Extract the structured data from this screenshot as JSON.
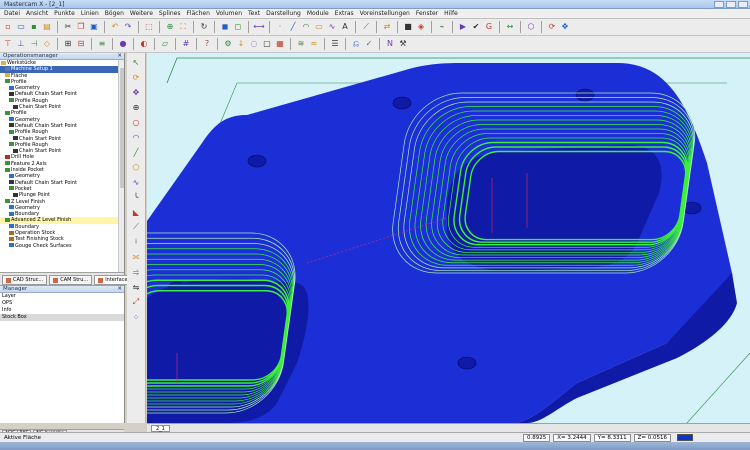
{
  "window": {
    "title": "Mastercam X  -  [2_1]"
  },
  "menu": [
    "Datei",
    "Ansicht",
    "Punkte",
    "Linien",
    "Bögen",
    "Weitere",
    "Splines",
    "Flächen",
    "Volumen",
    "Text",
    "Darstellung",
    "Module",
    "Extras",
    "Voreinstellungen",
    "Fenster",
    "Hilfe"
  ],
  "toolbar1": [
    "new-icon",
    "open-icon",
    "save-icon",
    "print-icon",
    "sep",
    "cut-icon",
    "copy-icon",
    "paste-icon",
    "sep",
    "undo-icon",
    "redo-icon",
    "sep",
    "select-all-icon",
    "sep",
    "zoom-icon",
    "fit-icon",
    "sep",
    "repaint-icon",
    "sep",
    "shade-icon",
    "wire-icon",
    "sep",
    "measure-icon",
    "sep",
    "point-icon",
    "line-icon",
    "arc-icon",
    "rect-icon",
    "spline-icon",
    "text-icon",
    "sep",
    "trim-icon",
    "sep",
    "xform-icon",
    "sep",
    "solid-icon",
    "surface-icon",
    "sep",
    "toolpath-icon",
    "sep",
    "simulate-icon",
    "verify-icon",
    "post-icon",
    "sep",
    "dim-icon",
    "sep",
    "wireframe-icon",
    "sep",
    "rotate-icon",
    "pan-icon"
  ],
  "toolbar2": [
    "view-top-icon",
    "view-front-icon",
    "view-side-icon",
    "view-iso-icon",
    "sep",
    "cplane-icon",
    "tplane-icon",
    "sep",
    "level-icon",
    "sep",
    "color-icon",
    "sep",
    "attr-icon",
    "sep",
    "plane-icon",
    "sep",
    "grid-icon",
    "sep",
    "analyze-icon",
    "sep",
    "mill-icon",
    "drill-icon",
    "contour-icon",
    "pocket-icon",
    "face-icon",
    "sep",
    "rough-icon",
    "finish-icon",
    "sep",
    "ops-icon",
    "sep",
    "backplot-icon",
    "verify2-icon",
    "sep",
    "nc-icon",
    "setup-icon"
  ],
  "ops_panel": {
    "header": "Operationsmanager"
  },
  "tree": [
    {
      "label": "Werkstücke",
      "indent": 0,
      "icon": "folder-icon"
    },
    {
      "label": "Machine Setup 1",
      "indent": 1,
      "icon": "machine-icon",
      "state": "selected"
    },
    {
      "label": "Fläche",
      "indent": 1,
      "icon": "folder-icon"
    },
    {
      "label": "Profile",
      "indent": 1,
      "icon": "op-icon"
    },
    {
      "label": "Geometry",
      "indent": 2,
      "icon": "geom-icon"
    },
    {
      "label": "Default Chain Start Point",
      "indent": 2,
      "icon": "pin-icon"
    },
    {
      "label": "Profile Rough",
      "indent": 2,
      "icon": "op-icon"
    },
    {
      "label": "Chain Start Point",
      "indent": 3,
      "icon": "pin-icon"
    },
    {
      "label": "Profile",
      "indent": 1,
      "icon": "op-icon"
    },
    {
      "label": "Geometry",
      "indent": 2,
      "icon": "geom-icon"
    },
    {
      "label": "Default Chain Start Point",
      "indent": 2,
      "icon": "pin-icon"
    },
    {
      "label": "Profile Rough",
      "indent": 2,
      "icon": "op-icon"
    },
    {
      "label": "Chain Start Point",
      "indent": 3,
      "icon": "pin-icon"
    },
    {
      "label": "Profile Rough",
      "indent": 2,
      "icon": "op-icon"
    },
    {
      "label": "Chain Start Point",
      "indent": 3,
      "icon": "pin-icon"
    },
    {
      "label": "Drill Hole",
      "indent": 1,
      "icon": "drill-icon"
    },
    {
      "label": "Feature 2 Axis",
      "indent": 1,
      "icon": "op-icon"
    },
    {
      "label": "Inside Pocket",
      "indent": 1,
      "icon": "op-icon"
    },
    {
      "label": "Geometry",
      "indent": 2,
      "icon": "geom-icon"
    },
    {
      "label": "Default Chain Start Point",
      "indent": 2,
      "icon": "pin-icon"
    },
    {
      "label": "Pocket",
      "indent": 2,
      "icon": "op-icon"
    },
    {
      "label": "Plunge Point",
      "indent": 3,
      "icon": "pin-icon"
    },
    {
      "label": "Z Level Finish",
      "indent": 1,
      "icon": "op-icon"
    },
    {
      "label": "Geometry",
      "indent": 2,
      "icon": "geom-icon"
    },
    {
      "label": "Boundary",
      "indent": 2,
      "icon": "geom-icon"
    },
    {
      "label": "Advanced Z Level Finish",
      "indent": 1,
      "icon": "op-icon",
      "state": "highlight"
    },
    {
      "label": "Boundary",
      "indent": 2,
      "icon": "geom-icon"
    },
    {
      "label": "Operation Stock",
      "indent": 2,
      "icon": "stock-icon"
    },
    {
      "label": "Test Finishing Stock",
      "indent": 2,
      "icon": "stock-icon"
    },
    {
      "label": "Gouge Check Surfaces",
      "indent": 2,
      "icon": "geom-icon"
    }
  ],
  "tabs": [
    {
      "label": "CAD Struc...",
      "active": false
    },
    {
      "label": "CAM Stru...",
      "active": false
    },
    {
      "label": "Interface Ma...",
      "active": true
    }
  ],
  "manager": {
    "header": "Manager",
    "rows": [
      {
        "label": "Layer",
        "selected": false
      },
      {
        "label": "OPS",
        "selected": false
      },
      {
        "label": "Info",
        "selected": false
      },
      {
        "label": "Stock Box",
        "selected": true
      }
    ]
  },
  "bottom_tabs": [
    "ASIS / BKS",
    "NC Ausgabe"
  ],
  "vtools": [
    "select-icon",
    "rotate-icon",
    "pan-icon",
    "zoom-icon",
    "circle-icon",
    "arc-icon",
    "line-icon",
    "polygon-icon",
    "spline-icon",
    "fillet-icon",
    "chamfer-icon",
    "trim-icon",
    "break-icon",
    "join-icon",
    "offset-icon",
    "mirror-icon",
    "scale-icon",
    "array-icon"
  ],
  "viewport": {
    "tab": "2_1",
    "colors": {
      "background": "#d4f2f7",
      "part": "#1c2fd6",
      "part_dark": "#0f1aa6",
      "toolpath": "#3cf03c",
      "toolpath_light": "#a8f0b8",
      "plunge": "#e0286e"
    }
  },
  "status": {
    "text": "Aktive Fläche",
    "zoom": "0.8925",
    "x": "X= 3.2444",
    "y": "Y= 8.3311",
    "z": "Z= 0.0516"
  }
}
